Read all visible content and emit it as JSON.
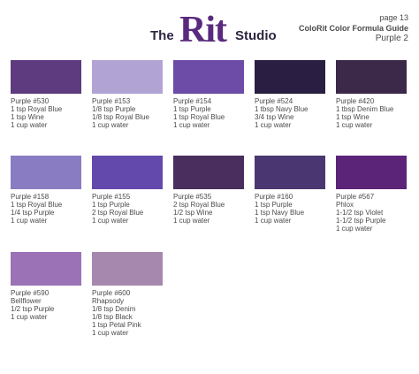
{
  "header": {
    "logo_the": "The",
    "logo_rit": "Rit",
    "logo_studio": "Studio",
    "page": "page 13",
    "guide": "ColoRit Color Formula Guide",
    "section": "Purple 2"
  },
  "swatches": [
    {
      "color": "#5e3a7e",
      "lines": [
        "Purple #530",
        "1 tsp Royal Blue",
        "1 tsp Wine",
        "1 cup water"
      ]
    },
    {
      "color": "#b1a4d4",
      "lines": [
        "Purple #153",
        "1/8 tsp Purple",
        "1/8 tsp Royal Blue",
        "1 cup water"
      ]
    },
    {
      "color": "#6c4ca7",
      "lines": [
        "Purple #154",
        "1 tsp Purple",
        "1 tsp Royal Blue",
        "1 cup water"
      ]
    },
    {
      "color": "#2a1f42",
      "lines": [
        "Purple #524",
        "1 tbsp Navy Blue",
        "3/4 tsp Wine",
        "1 cup water"
      ]
    },
    {
      "color": "#3c2848",
      "lines": [
        "Purple #420",
        "1 tbsp Denim Blue",
        "1 tsp Wine",
        "1 cup water"
      ]
    },
    {
      "color": "#8a7cc2",
      "lines": [
        "Purple #158",
        "1 tsp Royal Blue",
        "1/4 tsp Purple",
        "1 cup water"
      ]
    },
    {
      "color": "#6449ad",
      "lines": [
        "Purple #155",
        "1 tsp Purple",
        "2 tsp Royal Blue",
        "1 cup water"
      ]
    },
    {
      "color": "#4a2e5e",
      "lines": [
        "Purple #535",
        "2  tsp Royal Blue",
        "1/2 tsp Wine",
        "1 cup water"
      ]
    },
    {
      "color": "#4a3772",
      "lines": [
        "Purple #160",
        "1 tsp Purple",
        "1 tsp Navy Blue",
        "1 cup water"
      ]
    },
    {
      "color": "#5c2478",
      "lines": [
        "Purple #567",
        "Phlox",
        "1-1/2 tsp Violet",
        "1-1/2 tsp Purple",
        "1 cup water"
      ]
    },
    {
      "color": "#9c72b6",
      "lines": [
        "Purple #590",
        "Bellflower",
        "1/2 tsp Purple",
        "1 cup water"
      ]
    },
    {
      "color": "#a688ae",
      "lines": [
        "Purple #600",
        "Rhapsody",
        "1/8 tsp Denim",
        "1/8 tsp Black",
        "1 tsp Petal Pink",
        "1 cup water"
      ]
    }
  ]
}
